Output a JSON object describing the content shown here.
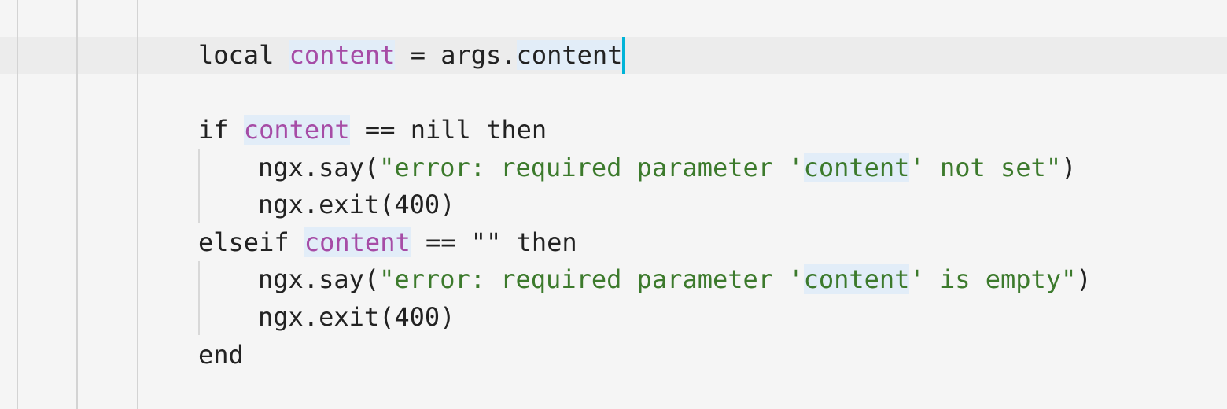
{
  "colors": {
    "background": "#f5f5f5",
    "current_line": "#ececec",
    "variable": "#a64ca6",
    "string": "#3c7a2c",
    "highlight": "#e2edf8",
    "cursor": "#00b4d8"
  },
  "code": {
    "line1": {
      "kw": "local ",
      "var": "content",
      "op": " = args.",
      "field": "content"
    },
    "line3": {
      "kw": "if ",
      "var": "content",
      "rest": " == nill then"
    },
    "line4": {
      "pre": "ngx.say(",
      "str_a": "\"error: required parameter '",
      "str_b": "content",
      "str_c": "' not set\"",
      "post": ")"
    },
    "line5": {
      "text": "ngx.exit(400)"
    },
    "line6": {
      "kw": "elseif ",
      "var": "content",
      "rest": " == \"\" then"
    },
    "line7": {
      "pre": "ngx.say(",
      "str_a": "\"error: required parameter '",
      "str_b": "content",
      "str_c": "' is empty\"",
      "post": ")"
    },
    "line8": {
      "text": "ngx.exit(400)"
    },
    "line9": {
      "text": "end"
    }
  }
}
